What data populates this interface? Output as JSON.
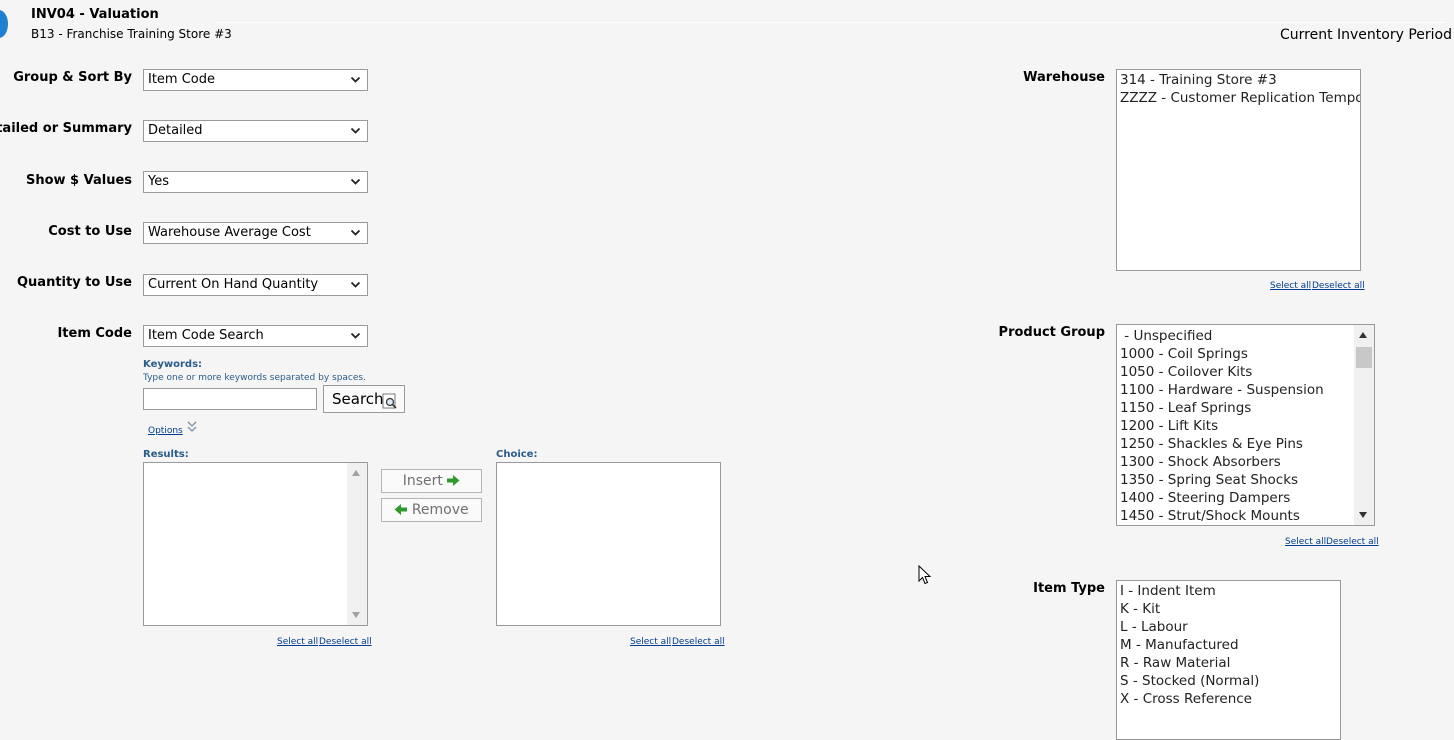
{
  "header": {
    "title": "INV04 - Valuation",
    "subtitle": "B13 - Franchise Training Store #3",
    "period": "Current Inventory Period"
  },
  "filters": {
    "group_sort": {
      "label": "Group & Sort By",
      "value": "Item Code"
    },
    "detail_summary": {
      "label": "Detailed or Summary",
      "value": "Detailed"
    },
    "show_values": {
      "label": "Show $ Values",
      "value": "Yes"
    },
    "cost_to_use": {
      "label": "Cost to Use",
      "value": "Warehouse Average Cost"
    },
    "qty_to_use": {
      "label": "Quantity to Use",
      "value": "Current On Hand Quantity"
    },
    "item_code": {
      "label": "Item Code",
      "value": "Item Code Search"
    }
  },
  "item_search": {
    "keywords_label": "Keywords:",
    "keywords_hint": "Type one or more keywords separated by spaces.",
    "keywords_value": "",
    "search_button": "Search",
    "options_link": "Options",
    "results_label": "Results:",
    "choice_label": "Choice:",
    "insert_button": "Insert",
    "remove_button": "Remove",
    "results_select_all": "Select all",
    "results_deselect_all": "Deselect all",
    "choice_select_all": "Select all",
    "choice_deselect_all": "Deselect all"
  },
  "warehouse": {
    "label": "Warehouse",
    "items": [
      "314 - Training Store #3",
      "ZZZZ - Customer Replication Temporary"
    ],
    "select_all": "Select all",
    "deselect_all": "Deselect all"
  },
  "product_group": {
    "label": "Product Group",
    "items": [
      " - Unspecified",
      "1000 - Coil Springs",
      "1050 - Coilover Kits",
      "1100 - Hardware - Suspension",
      "1150 - Leaf Springs",
      "1200 - Lift Kits",
      "1250 - Shackles & Eye Pins",
      "1300 - Shock Absorbers",
      "1350 - Spring Seat Shocks",
      "1400 - Steering Dampers",
      "1450 - Strut/Shock Mounts"
    ],
    "select_all": "Select all",
    "deselect_all": "Deselect all"
  },
  "item_type": {
    "label": "Item Type",
    "items": [
      "I - Indent Item",
      "K - Kit",
      "L - Labour",
      "M - Manufactured",
      "R - Raw Material",
      "S - Stocked (Normal)",
      "X - Cross Reference"
    ]
  },
  "colors": {
    "background": "#f5f5f5",
    "link": "#003c8f",
    "arrow_green": "#2e9a2e"
  }
}
